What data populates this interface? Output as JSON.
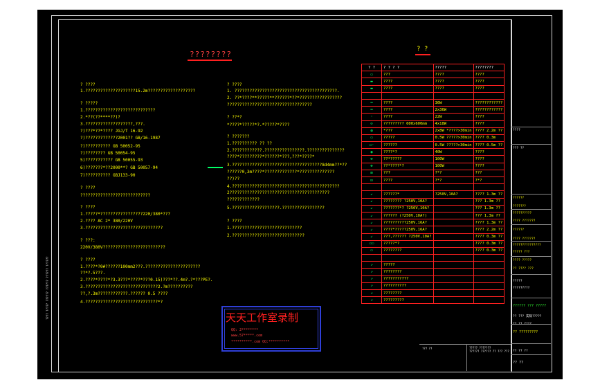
{
  "title": "????????",
  "left_lines": [
    "? ????",
    "1.????????????????????15.2m???????????????????",
    "? ?????",
    "1.????????????????????????????",
    "2.*??(??****??)?",
    "3.???????????????????,???.",
    "?)???*??*????      JGJ/T 16-92",
    "?)?????????????2001??    GB/16-1987",
    "?)??????????      GB 50052-95",
    "?)????????      GB 50054-95",
    "5)???????????     GB 50055-93",
    "6)???????*??2000**?    GB 50057-94",
    "7)??????????      GBJ133-90",
    "? ????",
    " ????????????????????????????",
    "? ????",
    "1.?????*?????????????????220/380*???",
    "2.????  AC  2* 380/220V",
    "3.???????????????????????????????",
    "? ???:",
    "220V/380V?????????????????????????",
    "? ????",
    "1.????*?0#??????100mm2???.??????????????????????",
    "  ??*?.5???.",
    "2.????*????*?3.3???*????*???0.15)???*??.4m?.?*???PE?.",
    "3.?????????????????????????????2.?m??????????",
    "  ??,?.3m????????????.?????? 0.5 ????",
    "4.?????????????????????????????*?"
  ],
  "mid_lines": [
    "? ????",
    "1. ?????????????????????????????????????????.",
    "2. ??*????**?????**??????*??*?????????????????",
    "   ??????????????????????????????????",
    "? ??*?",
    "   *????*?????*?.*?????*????",
    "? ???????",
    "1.??????????  ?? ??",
    "2.????????????.????????????????.???????????????",
    "   ????*?????????*??????*???,???*????*",
    "3.????????????????????????????????????8d4mm??*??",
    "   ??????0,3m????*?????????????*??????????????",
    "   ??)??",
    "4.???????????????????????????????????????????",
    "   2????????????????????????????????????????",
    "   ?????????????",
    "5.???????????????????.?????????????????",
    "? ????",
    "1.????????????????????????????",
    "2.?????????????????????????????"
  ],
  "legend": {
    "title": "? ?",
    "header": [
      "?  ?",
      "?  ?  ?  ?",
      "?????",
      "????????"
    ],
    "rows": [
      [
        "▭",
        "???",
        "????",
        "????"
      ],
      [
        "▬",
        "????",
        "????",
        "????"
      ],
      [
        "▬",
        "????",
        "????",
        "????"
      ],
      [
        "",
        "",
        "",
        ""
      ],
      [
        "━",
        "????",
        "36W",
        "????????????"
      ],
      [
        "━",
        "????",
        "2x36W",
        "????????????"
      ],
      [
        "◦",
        "????",
        "22W",
        "????"
      ],
      [
        "⊙",
        "?????????  600x600mm",
        "4x18W",
        "????"
      ],
      [
        "◍",
        "*???",
        "2x8W *????>30min",
        "???? 2.2m ??"
      ],
      [
        "▭",
        "?????",
        "0.5W ?????>30min",
        "???? 0.3m"
      ],
      [
        "▭◦",
        "??????",
        "0.5W ?????>30min",
        "???? 0.5m ??"
      ],
      [
        "◉",
        "????*?",
        "40W",
        "????"
      ],
      [
        "⊕",
        "??*?????",
        "100W",
        "????"
      ],
      [
        "⊛",
        "??*????*?",
        "100W",
        "????"
      ],
      [
        "⊠",
        "???",
        "?*?",
        "???"
      ],
      [
        "⊡",
        "????",
        "?*?",
        "?*?"
      ],
      [
        "",
        "",
        "",
        ""
      ],
      [
        "↙",
        "??????*",
        "?250V,10A?",
        "???? 1.3m ??"
      ],
      [
        "↙",
        "???????? ?250V,10A?",
        "",
        "??? 1.3m ??"
      ],
      [
        "↙",
        "???????*? ?250V,10A?",
        "",
        "??? 1.3m ??"
      ],
      [
        "↙",
        "?????? (?250V,10A?)",
        "",
        "??? 1.3m ??"
      ],
      [
        "↙",
        "??????????250V,16A?",
        "",
        "???? 1.3m ??"
      ],
      [
        "↙",
        "????*?????250V,16A?",
        "",
        "???? 2.2m ??"
      ],
      [
        "↙",
        "???,?????? ?250V,10A?",
        "",
        "???? 0.3m ??"
      ],
      [
        "▭▭",
        "?????*?",
        "",
        "???? 0.3m ??"
      ],
      [
        "▭",
        "????????",
        "",
        "???? 0.3m ??"
      ],
      [
        "",
        "",
        "",
        ""
      ],
      [
        "↗",
        "?????",
        "",
        ""
      ],
      [
        "↗",
        "????????",
        "",
        ""
      ],
      [
        "↗",
        "???????????",
        "",
        ""
      ],
      [
        "↗",
        "??????????",
        "",
        ""
      ],
      [
        "↗",
        "????????",
        "",
        ""
      ],
      [
        "↗",
        "?????????",
        "",
        ""
      ]
    ]
  },
  "stamp": {
    "cn": "天天工作室录制",
    "line1": "QQ: 2********",
    "line2": "www.57*****.com",
    "line3": "**********.com  QQ:**********"
  },
  "titleblock": {
    "items": [
      "????",
      "??? ??",
      "??????",
      "???????",
      "??????????",
      "???? ???????",
      "??????",
      "???? ???????",
      "???????????????",
      "????? ???",
      "???? ?????",
      "?? ???? ???",
      "?????",
      "?????????",
      "?? ??? 实际?????",
      "?? ?? ????",
      "?? ?? ??"
    ],
    "project": "?????? ??? ?????",
    "drawing": "?? ?????????",
    "sheet_no": "?? ??"
  },
  "bottom_strip": {
    "c1": "??? ??",
    "c2": "????? ???????\n?????? ?????? ?? ??? ???"
  },
  "side_text": "???? ????? ?????? ?????? ?????? ??????"
}
